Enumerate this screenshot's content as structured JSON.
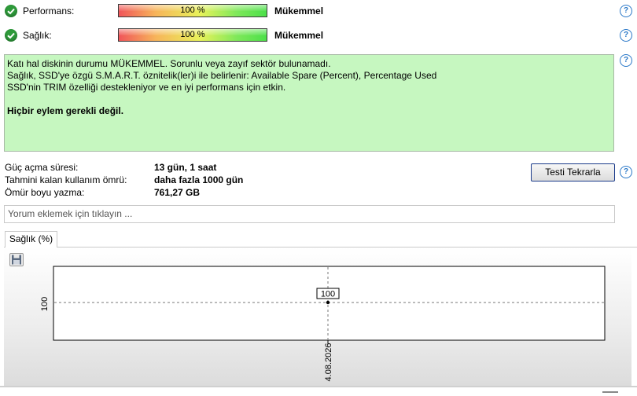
{
  "status_rows": [
    {
      "label": "Performans:",
      "value": "100 %",
      "verdict": "Mükemmel",
      "icon": "check-circle-icon"
    },
    {
      "label": "Sağlık:",
      "value": "100 %",
      "verdict": "Mükemmel",
      "icon": "check-circle-icon"
    }
  ],
  "help_icon": "?",
  "info": {
    "lines": [
      "Katı hal diskinin durumu MÜKEMMEL. Sorunlu veya zayıf sektör bulunamadı.",
      "Sağlık, SSD'ye özgü S.M.A.R.T. öznitelik(ler)i ile belirlenir:  Available Spare (Percent), Percentage Used",
      "SSD'nin TRIM özelliği destekleniyor ve en iyi performans için etkin."
    ],
    "action": "Hiçbir eylem gerekli değil.",
    "background_color": "#c6f7c0"
  },
  "stats": {
    "power_on_label": "Güç açma süresi:",
    "power_on_value": "13 gün, 1 saat",
    "lifetime_label": "Tahmini kalan kullanım ömrü:",
    "lifetime_value": "daha fazla 1000 gün",
    "writes_label": "Ömür boyu yazma:",
    "writes_value": "761,27 GB"
  },
  "retest_button": "Testi Tekrarla",
  "comment_placeholder": "Yorum eklemek için tıklayın ...",
  "tab_label": "Sağlık (%)",
  "save_icon": "floppy-disk-icon",
  "chart_data": {
    "type": "scatter",
    "series": [
      {
        "x": [
          "4.08.2026"
        ],
        "values": [
          100
        ]
      }
    ],
    "point_labels": [
      "100"
    ],
    "y_ticks": [
      "100"
    ],
    "x_ticks": [
      "4.08.2026"
    ],
    "grid": "dashed crosshair"
  }
}
